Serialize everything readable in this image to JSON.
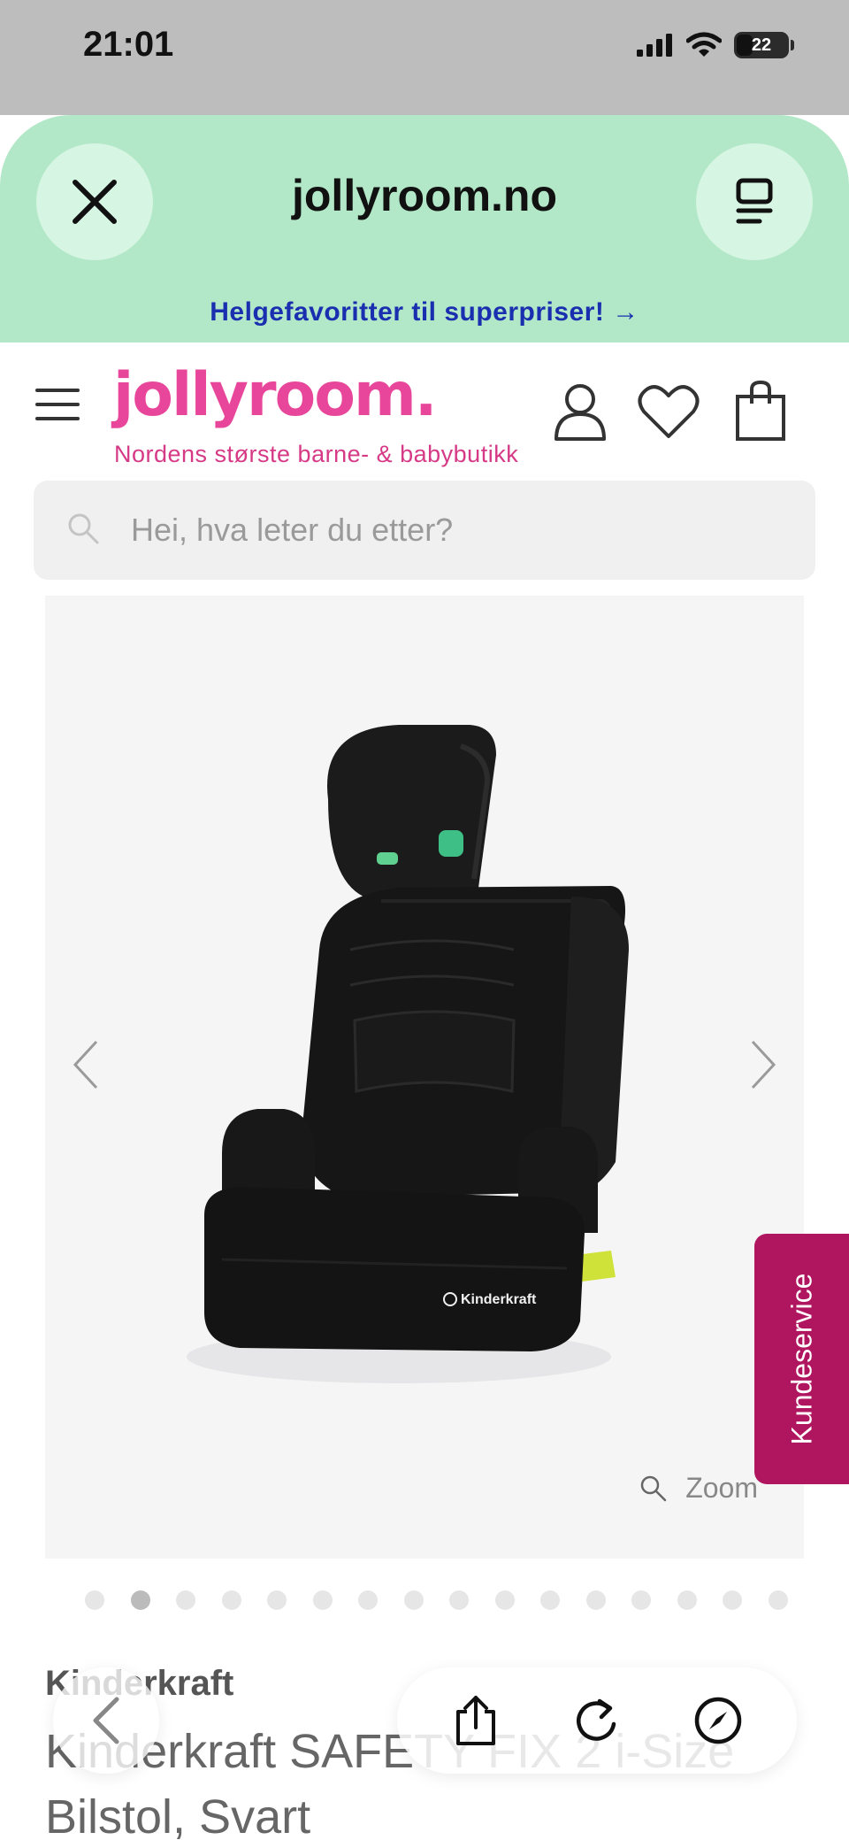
{
  "status_bar": {
    "time": "21:01",
    "battery": "22"
  },
  "browser": {
    "url": "jollyroom.no",
    "promo": "Helgefavoritter til superpriser! →"
  },
  "site": {
    "logo": "jollyroom.",
    "tagline": "Nordens største barne- & babybutikk",
    "search_placeholder": "Hei, hva leter du etter?"
  },
  "product": {
    "brand": "Kinderkraft",
    "title": "Kinderkraft SAFETY FIX 2 i-Size Bilstol, Svart",
    "zoom_label": "Zoom",
    "seat_brand": "Kinderkraft",
    "gallery_count": 16,
    "gallery_active": 2
  },
  "kundeservice": "Kundeservice",
  "colors": {
    "header_green": "#b2e8c8",
    "brand_pink": "#e8469a",
    "kundeservice": "#b0155f",
    "promo_blue": "#1a2fb0"
  }
}
